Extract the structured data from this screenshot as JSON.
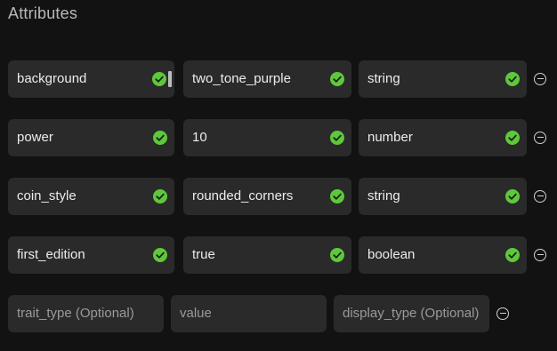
{
  "title": "Attributes",
  "accent_color": "#5dc93a",
  "rows": [
    {
      "trait_type": "background",
      "value": "two_tone_purple",
      "display_type": "string"
    },
    {
      "trait_type": "power",
      "value": "10",
      "display_type": "number"
    },
    {
      "trait_type": "coin_style",
      "value": "rounded_corners",
      "display_type": "string"
    },
    {
      "trait_type": "first_edition",
      "value": "true",
      "display_type": "boolean"
    }
  ],
  "new_row": {
    "trait_type_placeholder": "trait_type (Optional)",
    "value_placeholder": "value",
    "display_type_placeholder": "display_type (Optional)"
  },
  "icons": {
    "valid": "check-circle-icon",
    "remove": "minus-circle-icon"
  }
}
